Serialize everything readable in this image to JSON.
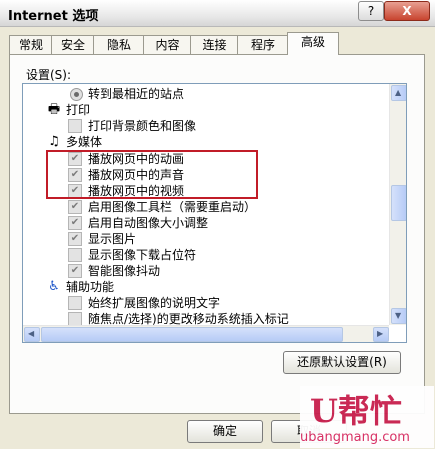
{
  "window": {
    "title": "Internet 选项",
    "help_glyph": "?",
    "close_glyph": "X"
  },
  "tabs": [
    "常规",
    "安全",
    "隐私",
    "内容",
    "连接",
    "程序",
    "高级"
  ],
  "active_tab": "高级",
  "settings_label": "设置(S):",
  "list": {
    "rows": [
      {
        "type": "radio",
        "label": "转到最相近的站点",
        "checked": true
      },
      {
        "type": "category",
        "icon": "printer-icon",
        "label": "打印"
      },
      {
        "type": "checkbox",
        "label": "打印背景颜色和图像",
        "checked": false
      },
      {
        "type": "category",
        "icon": "multimedia-icon",
        "label": "多媒体"
      },
      {
        "type": "checkbox",
        "label": "播放网页中的动画",
        "checked": true
      },
      {
        "type": "checkbox",
        "label": "播放网页中的声音",
        "checked": true
      },
      {
        "type": "checkbox",
        "label": "播放网页中的视频",
        "checked": true
      },
      {
        "type": "checkbox",
        "label": "启用图像工具栏（需要重启动）",
        "checked": true
      },
      {
        "type": "checkbox",
        "label": "启用自动图像大小调整",
        "checked": true
      },
      {
        "type": "checkbox",
        "label": "显示图片",
        "checked": true
      },
      {
        "type": "checkbox",
        "label": "显示图像下载占位符",
        "checked": false
      },
      {
        "type": "checkbox",
        "label": "智能图像抖动",
        "checked": true
      },
      {
        "type": "category",
        "icon": "accessibility-icon",
        "label": "辅助功能"
      },
      {
        "type": "checkbox",
        "label": "始终扩展图像的说明文字",
        "checked": false
      },
      {
        "type": "checkbox",
        "label": "随焦点/选择)的更改移动系统插入标记",
        "checked": false
      }
    ]
  },
  "buttons": {
    "restore": "还原默认设置(R)",
    "ok": "确定",
    "cancel": "取消"
  },
  "watermark": {
    "logo": "U帮忙",
    "url": "ubangmang.com"
  },
  "colors": {
    "highlight": "#c11c28",
    "watermark": "#c81f4d"
  }
}
